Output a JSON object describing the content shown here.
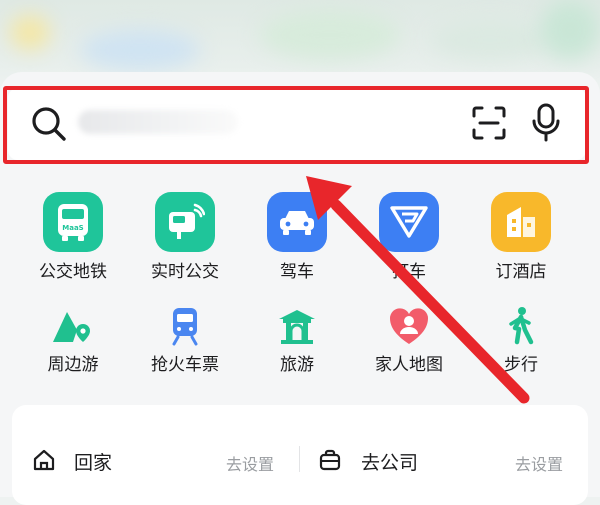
{
  "search": {
    "placeholder": "",
    "icons": [
      "search-icon",
      "scan-icon",
      "microphone-icon"
    ]
  },
  "quick_actions_row1": [
    {
      "label": "公交地铁",
      "icon": "bus-icon",
      "color": "#1fc59a",
      "tile_text": "MaaS"
    },
    {
      "label": "实时公交",
      "icon": "realtime-bus-icon",
      "color": "#1fc59a"
    },
    {
      "label": "驾车",
      "icon": "car-icon",
      "color": "#3d7ff3"
    },
    {
      "label": "打车",
      "icon": "taxi-icon",
      "color": "#3d7ff3"
    },
    {
      "label": "订酒店",
      "icon": "hotel-icon",
      "color": "#f8b82b"
    }
  ],
  "quick_actions_row2": [
    {
      "label": "周边游",
      "icon": "location-pin-icon",
      "color": "#20c08f"
    },
    {
      "label": "抢火车票",
      "icon": "train-icon",
      "color": "#4a86f0"
    },
    {
      "label": "旅游",
      "icon": "pavilion-icon",
      "color": "#20c08f"
    },
    {
      "label": "家人地图",
      "icon": "family-heart-icon",
      "color": "#f25c6a"
    },
    {
      "label": "步行",
      "icon": "walking-icon",
      "color": "#20c08f"
    }
  ],
  "shortcuts": {
    "home_label": "回家",
    "home_hint": "去设置",
    "work_label": "去公司",
    "work_hint": "去设置"
  },
  "annotation_color": "#e8262b"
}
